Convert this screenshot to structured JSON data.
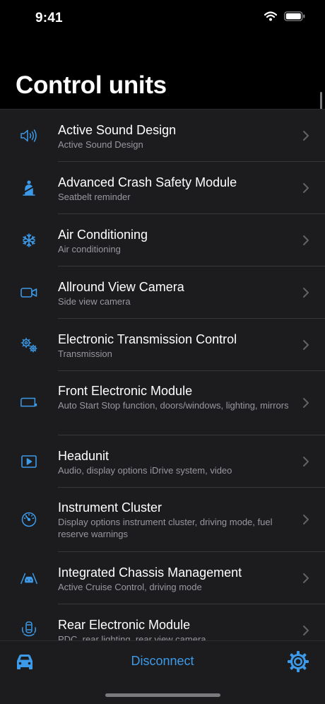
{
  "status": {
    "time": "9:41"
  },
  "page": {
    "title": "Control units"
  },
  "units": [
    {
      "label": "Active Sound Design",
      "sub": "Active Sound Design",
      "icon": "speaker-icon"
    },
    {
      "label": "Advanced Crash Safety Module",
      "sub": "Seatbelt reminder",
      "icon": "seatbelt-icon"
    },
    {
      "label": "Air Conditioning",
      "sub": "Air conditioning",
      "icon": "snowflake-icon"
    },
    {
      "label": "Allround View Camera",
      "sub": "Side view camera",
      "icon": "camera-icon"
    },
    {
      "label": "Electronic Transmission Control",
      "sub": "Transmission",
      "icon": "gears-icon"
    },
    {
      "label": "Front Electronic Module",
      "sub": "Auto Start Stop function, doors/windows, lighting, mirrors",
      "icon": "window-icon"
    },
    {
      "label": "Headunit",
      "sub": "Audio, display options iDrive system, video",
      "icon": "play-icon"
    },
    {
      "label": "Instrument Cluster",
      "sub": "Display options instrument cluster, driving mode, fuel reserve warnings",
      "icon": "gauge-icon"
    },
    {
      "label": "Integrated Chassis Management",
      "sub": "Active Cruise Control, driving mode",
      "icon": "lane-assist-icon"
    },
    {
      "label": "Rear Electronic Module",
      "sub": "PDC, rear lighting, rear view camera",
      "icon": "parking-sensor-icon"
    }
  ],
  "tabbar": {
    "disconnect_label": "Disconnect",
    "left_icon": "car-icon",
    "right_icon": "settings-icon"
  },
  "colors": {
    "accent": "#3d9ae8",
    "row_bg": "#1c1c1e",
    "background": "#000000"
  }
}
